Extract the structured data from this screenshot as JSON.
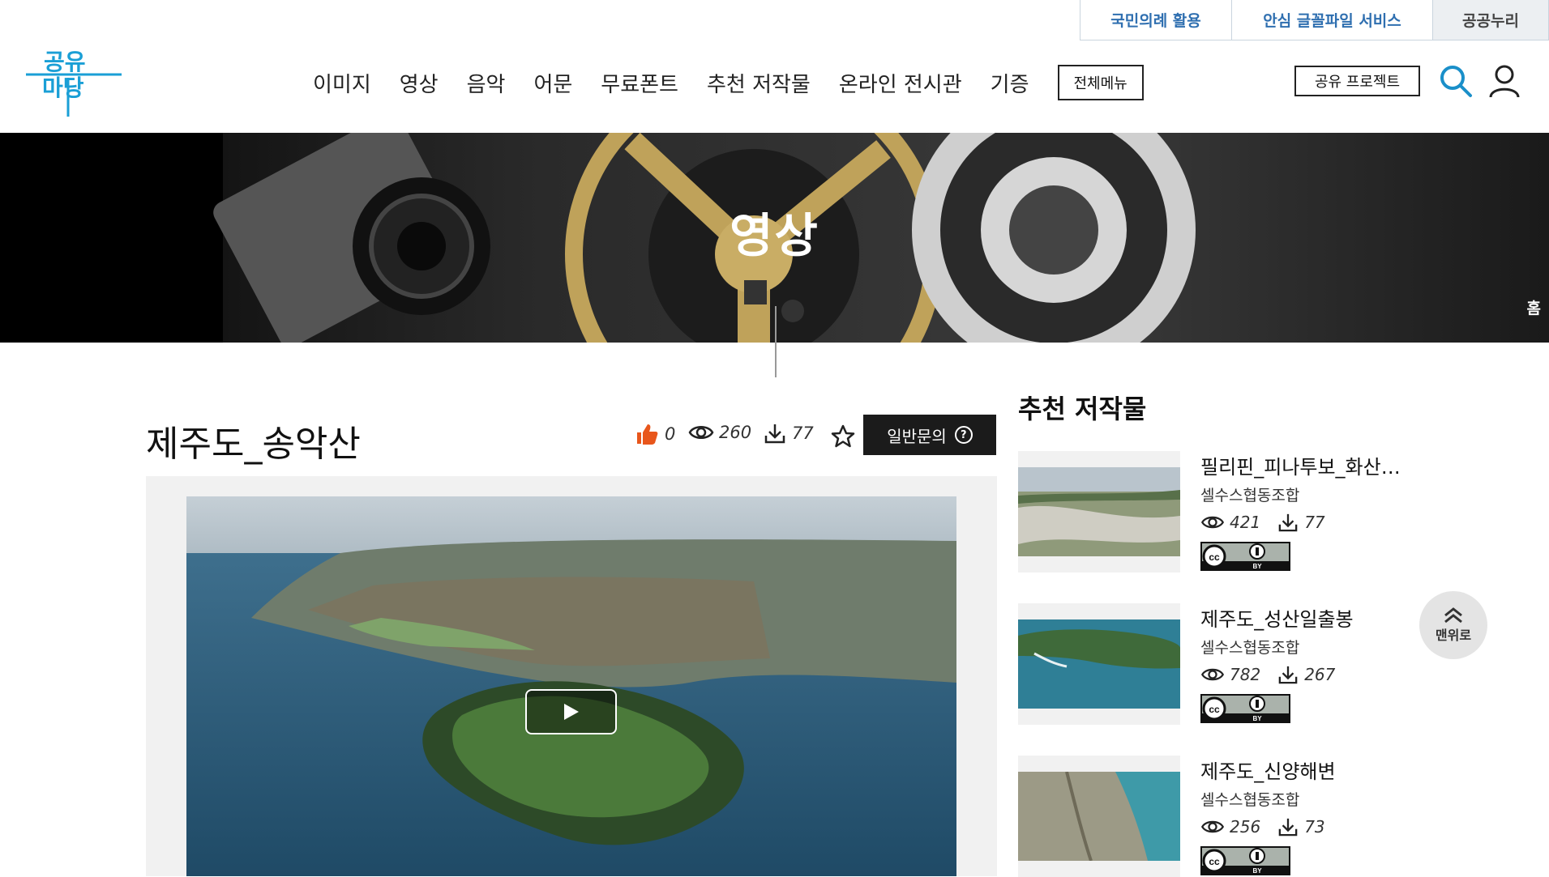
{
  "util_links": [
    "국민의례 활용",
    "안심 글꼴파일 서비스",
    "공공누리"
  ],
  "logo": {
    "text": "공유마당"
  },
  "nav": {
    "items": [
      "이미지",
      "영상",
      "음악",
      "어문",
      "무료폰트",
      "추천 저작물",
      "온라인 전시관",
      "기증"
    ],
    "all_menu": "전체메뉴",
    "project_button": "공유 프로젝트"
  },
  "banner": {
    "title": "영상",
    "home": "홈"
  },
  "content": {
    "title": "제주도_송악산",
    "likes": "0",
    "views": "260",
    "downloads": "77",
    "inquiry_button": "일반문의",
    "inquiry_icon": "?"
  },
  "recommended": {
    "title": "추천 저작물",
    "items": [
      {
        "name": "필리핀_피나투보_화산…",
        "org": "셀수스협동조합",
        "views": "421",
        "downloads": "77"
      },
      {
        "name": "제주도_성산일출봉",
        "org": "셀수스협동조합",
        "views": "782",
        "downloads": "267"
      },
      {
        "name": "제주도_신양해변",
        "org": "셀수스협동조합",
        "views": "256",
        "downloads": "73"
      }
    ],
    "license_label": "BY"
  },
  "top_button": "맨위로",
  "colors": {
    "brand_blue": "#2f6fb0",
    "accent_orange": "#e8561b",
    "dark": "#1b1b1b"
  }
}
